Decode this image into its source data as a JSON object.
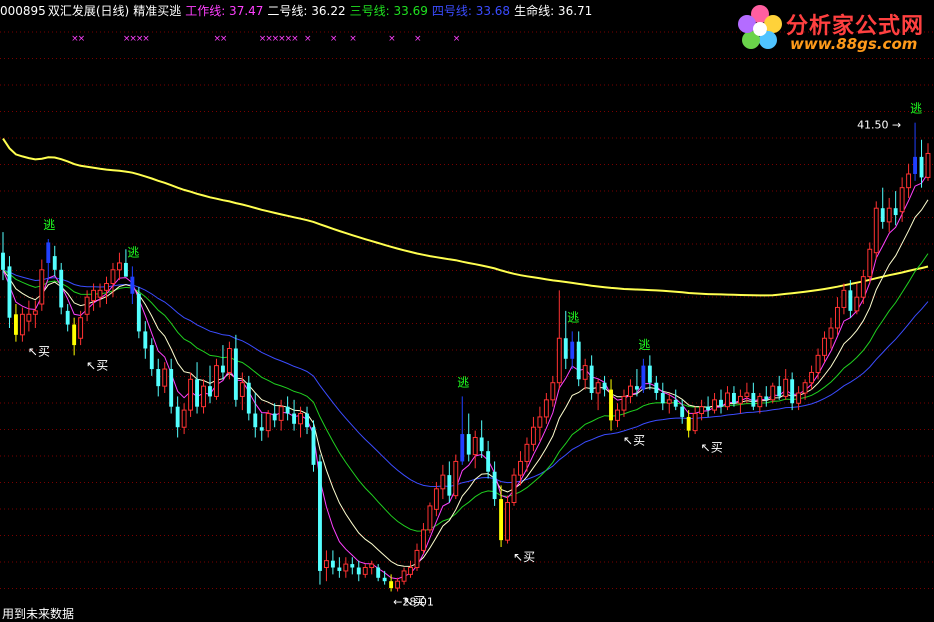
{
  "header": {
    "code": "000895",
    "name": "双汇发展(日线)",
    "indicator": "精准买逃",
    "work_label": "工作线: 37.47",
    "line2_label": "二号线: 36.22",
    "line3_label": "三号线: 33.69",
    "line4_label": "四号线: 33.68",
    "life_label": "生命线: 36.71"
  },
  "logo": {
    "title": "分析家公式网",
    "url": "www.88gs.com"
  },
  "footer": {
    "text": "用到未来数据"
  },
  "colors": {
    "up": "#ff3232",
    "down": "#54ffff",
    "work": "#ff40ff",
    "line2": "#ffffd0",
    "line3": "#20d020",
    "line4": "#3b4cff",
    "life": "#ffff50",
    "buy_bar": "#ffff00",
    "escape_bar": "#2040ff",
    "signal_text": "#20ff20",
    "grid": "#7a0000"
  },
  "chart_data": {
    "type": "candlestick",
    "y_range": [
      27.2,
      44.5
    ],
    "grid": "dotted horizontal",
    "max_label": "41.50",
    "min_label": "28.01",
    "signal_escape": "逃",
    "signal_buy": "买",
    "cross_mark": "×",
    "candles": [
      {
        "o": 37.7,
        "h": 38.3,
        "l": 36.9,
        "c": 37.2,
        "s": 0
      },
      {
        "o": 37.3,
        "h": 37.6,
        "l": 35.5,
        "c": 35.8,
        "s": 0
      },
      {
        "o": 35.9,
        "h": 36.2,
        "l": 35.1,
        "c": 35.3,
        "s": 1
      },
      {
        "o": 35.3,
        "h": 36.1,
        "l": 35.1,
        "c": 35.9,
        "s": 0
      },
      {
        "o": 35.7,
        "h": 36.3,
        "l": 35.4,
        "c": 35.9,
        "s": 0
      },
      {
        "o": 35.9,
        "h": 36.3,
        "l": 35.5,
        "c": 36.0,
        "s": 0
      },
      {
        "o": 36.2,
        "h": 37.5,
        "l": 36.0,
        "c": 37.2,
        "s": 0
      },
      {
        "o": 37.4,
        "h": 38.1,
        "l": 36.9,
        "c": 38.0,
        "s": 2
      },
      {
        "o": 37.6,
        "h": 37.9,
        "l": 37.0,
        "c": 37.2,
        "s": 0
      },
      {
        "o": 37.2,
        "h": 37.4,
        "l": 35.9,
        "c": 36.1,
        "s": 0
      },
      {
        "o": 36.0,
        "h": 36.2,
        "l": 35.4,
        "c": 35.6,
        "s": 0
      },
      {
        "o": 35.6,
        "h": 35.8,
        "l": 34.7,
        "c": 35.0,
        "s": 1
      },
      {
        "o": 35.2,
        "h": 36.0,
        "l": 35.0,
        "c": 35.8,
        "s": 0
      },
      {
        "o": 35.9,
        "h": 36.6,
        "l": 35.7,
        "c": 36.4,
        "s": 0
      },
      {
        "o": 36.3,
        "h": 36.8,
        "l": 36.0,
        "c": 36.6,
        "s": 0
      },
      {
        "o": 36.4,
        "h": 36.8,
        "l": 36.1,
        "c": 36.6,
        "s": 0
      },
      {
        "o": 36.6,
        "h": 37.0,
        "l": 36.2,
        "c": 36.8,
        "s": 0
      },
      {
        "o": 36.8,
        "h": 37.4,
        "l": 36.4,
        "c": 37.2,
        "s": 0
      },
      {
        "o": 37.2,
        "h": 37.7,
        "l": 36.9,
        "c": 37.4,
        "s": 0
      },
      {
        "o": 37.4,
        "h": 37.8,
        "l": 37.0,
        "c": 37.0,
        "s": 0
      },
      {
        "o": 37.0,
        "h": 37.3,
        "l": 36.2,
        "c": 36.5,
        "s": 2
      },
      {
        "o": 36.5,
        "h": 36.7,
        "l": 35.2,
        "c": 35.4,
        "s": 0
      },
      {
        "o": 35.4,
        "h": 35.7,
        "l": 34.6,
        "c": 34.9,
        "s": 0
      },
      {
        "o": 35.0,
        "h": 35.2,
        "l": 34.1,
        "c": 34.3,
        "s": 0
      },
      {
        "o": 34.3,
        "h": 34.6,
        "l": 33.5,
        "c": 33.8,
        "s": 0
      },
      {
        "o": 33.8,
        "h": 34.5,
        "l": 33.6,
        "c": 34.3,
        "s": 0
      },
      {
        "o": 34.3,
        "h": 34.6,
        "l": 33.0,
        "c": 33.2,
        "s": 0
      },
      {
        "o": 33.2,
        "h": 33.5,
        "l": 32.3,
        "c": 32.6,
        "s": 0
      },
      {
        "o": 32.6,
        "h": 33.3,
        "l": 32.4,
        "c": 33.1,
        "s": 0
      },
      {
        "o": 33.1,
        "h": 34.2,
        "l": 32.9,
        "c": 34.0,
        "s": 0
      },
      {
        "o": 34.0,
        "h": 34.5,
        "l": 33.0,
        "c": 33.2,
        "s": 0
      },
      {
        "o": 33.2,
        "h": 34.0,
        "l": 33.0,
        "c": 33.8,
        "s": 0
      },
      {
        "o": 33.8,
        "h": 34.4,
        "l": 33.3,
        "c": 33.5,
        "s": 0
      },
      {
        "o": 33.5,
        "h": 34.6,
        "l": 33.4,
        "c": 34.4,
        "s": 0
      },
      {
        "o": 34.4,
        "h": 35.0,
        "l": 34.0,
        "c": 34.2,
        "s": 0
      },
      {
        "o": 34.2,
        "h": 35.1,
        "l": 34.0,
        "c": 34.9,
        "s": 0
      },
      {
        "o": 34.9,
        "h": 35.3,
        "l": 33.2,
        "c": 33.4,
        "s": 0
      },
      {
        "o": 33.5,
        "h": 34.2,
        "l": 33.1,
        "c": 33.9,
        "s": 0
      },
      {
        "o": 33.9,
        "h": 34.1,
        "l": 32.8,
        "c": 33.0,
        "s": 0
      },
      {
        "o": 33.0,
        "h": 33.6,
        "l": 32.3,
        "c": 32.6,
        "s": 0
      },
      {
        "o": 32.6,
        "h": 33.0,
        "l": 32.2,
        "c": 32.5,
        "s": 0
      },
      {
        "o": 32.5,
        "h": 33.1,
        "l": 32.3,
        "c": 33.0,
        "s": 0
      },
      {
        "o": 33.0,
        "h": 33.3,
        "l": 32.6,
        "c": 32.8,
        "s": 0
      },
      {
        "o": 32.8,
        "h": 33.4,
        "l": 32.5,
        "c": 33.2,
        "s": 0
      },
      {
        "o": 33.2,
        "h": 33.5,
        "l": 32.8,
        "c": 33.0,
        "s": 0
      },
      {
        "o": 33.0,
        "h": 33.4,
        "l": 32.5,
        "c": 32.7,
        "s": 0
      },
      {
        "o": 32.7,
        "h": 33.2,
        "l": 32.3,
        "c": 33.0,
        "s": 0
      },
      {
        "o": 33.0,
        "h": 33.2,
        "l": 32.4,
        "c": 32.6,
        "s": 0
      },
      {
        "o": 32.6,
        "h": 32.8,
        "l": 31.3,
        "c": 31.5,
        "s": 0
      },
      {
        "o": 31.6,
        "h": 31.8,
        "l": 28.0,
        "c": 28.4,
        "s": 0
      },
      {
        "o": 28.5,
        "h": 29.0,
        "l": 28.1,
        "c": 28.7,
        "s": 0
      },
      {
        "o": 28.7,
        "h": 29.0,
        "l": 28.3,
        "c": 28.5,
        "s": 0
      },
      {
        "o": 28.5,
        "h": 28.8,
        "l": 28.2,
        "c": 28.4,
        "s": 0
      },
      {
        "o": 28.4,
        "h": 28.8,
        "l": 28.2,
        "c": 28.6,
        "s": 0
      },
      {
        "o": 28.6,
        "h": 28.8,
        "l": 28.3,
        "c": 28.5,
        "s": 0
      },
      {
        "o": 28.5,
        "h": 28.7,
        "l": 28.1,
        "c": 28.3,
        "s": 0
      },
      {
        "o": 28.3,
        "h": 28.6,
        "l": 28.2,
        "c": 28.5,
        "s": 0
      },
      {
        "o": 28.5,
        "h": 28.7,
        "l": 28.3,
        "c": 28.6,
        "s": 0
      },
      {
        "o": 28.5,
        "h": 28.6,
        "l": 28.1,
        "c": 28.2,
        "s": 0
      },
      {
        "o": 28.2,
        "h": 28.4,
        "l": 28.0,
        "c": 28.1,
        "s": 0
      },
      {
        "o": 28.1,
        "h": 28.3,
        "l": 27.8,
        "c": 27.9,
        "s": 1
      },
      {
        "o": 27.9,
        "h": 28.2,
        "l": 27.8,
        "c": 28.1,
        "s": 0
      },
      {
        "o": 28.1,
        "h": 28.5,
        "l": 28.0,
        "c": 28.4,
        "s": 0
      },
      {
        "o": 28.3,
        "h": 28.7,
        "l": 28.2,
        "c": 28.5,
        "s": 0
      },
      {
        "o": 28.5,
        "h": 29.2,
        "l": 28.4,
        "c": 29.0,
        "s": 0
      },
      {
        "o": 29.0,
        "h": 29.8,
        "l": 28.9,
        "c": 29.6,
        "s": 0
      },
      {
        "o": 29.6,
        "h": 30.4,
        "l": 29.5,
        "c": 30.3,
        "s": 0
      },
      {
        "o": 30.2,
        "h": 31.0,
        "l": 30.0,
        "c": 30.8,
        "s": 0
      },
      {
        "o": 30.8,
        "h": 31.5,
        "l": 30.5,
        "c": 31.2,
        "s": 0
      },
      {
        "o": 31.2,
        "h": 31.6,
        "l": 30.4,
        "c": 30.6,
        "s": 0
      },
      {
        "o": 30.6,
        "h": 31.8,
        "l": 30.5,
        "c": 31.6,
        "s": 0
      },
      {
        "o": 31.6,
        "h": 33.5,
        "l": 31.5,
        "c": 32.4,
        "s": 2
      },
      {
        "o": 32.4,
        "h": 33.0,
        "l": 31.6,
        "c": 31.8,
        "s": 0
      },
      {
        "o": 31.8,
        "h": 32.5,
        "l": 31.4,
        "c": 32.3,
        "s": 0
      },
      {
        "o": 32.3,
        "h": 32.8,
        "l": 31.7,
        "c": 31.9,
        "s": 0
      },
      {
        "o": 31.9,
        "h": 32.2,
        "l": 31.1,
        "c": 31.3,
        "s": 0
      },
      {
        "o": 31.3,
        "h": 31.6,
        "l": 30.3,
        "c": 30.5,
        "s": 0
      },
      {
        "o": 30.5,
        "h": 30.9,
        "l": 29.1,
        "c": 29.3,
        "s": 1
      },
      {
        "o": 29.3,
        "h": 30.6,
        "l": 29.2,
        "c": 30.4,
        "s": 0
      },
      {
        "o": 30.4,
        "h": 31.4,
        "l": 30.3,
        "c": 31.2,
        "s": 0
      },
      {
        "o": 31.2,
        "h": 31.9,
        "l": 30.9,
        "c": 31.6,
        "s": 0
      },
      {
        "o": 31.6,
        "h": 32.3,
        "l": 31.3,
        "c": 32.1,
        "s": 0
      },
      {
        "o": 32.1,
        "h": 32.9,
        "l": 31.9,
        "c": 32.6,
        "s": 0
      },
      {
        "o": 32.6,
        "h": 33.2,
        "l": 32.2,
        "c": 32.9,
        "s": 0
      },
      {
        "o": 32.9,
        "h": 33.6,
        "l": 32.7,
        "c": 33.4,
        "s": 0
      },
      {
        "o": 33.4,
        "h": 34.1,
        "l": 33.2,
        "c": 33.9,
        "s": 0
      },
      {
        "o": 33.9,
        "h": 36.6,
        "l": 33.7,
        "c": 35.2,
        "s": 0
      },
      {
        "o": 35.2,
        "h": 36.0,
        "l": 34.3,
        "c": 34.6,
        "s": 0
      },
      {
        "o": 34.6,
        "h": 35.4,
        "l": 34.3,
        "c": 35.1,
        "s": 2
      },
      {
        "o": 35.1,
        "h": 35.4,
        "l": 33.8,
        "c": 34.0,
        "s": 0
      },
      {
        "o": 34.0,
        "h": 34.6,
        "l": 33.7,
        "c": 34.4,
        "s": 0
      },
      {
        "o": 34.4,
        "h": 34.7,
        "l": 33.4,
        "c": 33.6,
        "s": 0
      },
      {
        "o": 33.6,
        "h": 34.0,
        "l": 33.1,
        "c": 33.9,
        "s": 0
      },
      {
        "o": 33.9,
        "h": 34.1,
        "l": 33.5,
        "c": 33.7,
        "s": 0
      },
      {
        "o": 33.7,
        "h": 34.0,
        "l": 32.5,
        "c": 32.8,
        "s": 1
      },
      {
        "o": 32.8,
        "h": 33.3,
        "l": 32.6,
        "c": 33.1,
        "s": 0
      },
      {
        "o": 33.1,
        "h": 33.7,
        "l": 32.9,
        "c": 33.5,
        "s": 0
      },
      {
        "o": 33.5,
        "h": 34.0,
        "l": 33.3,
        "c": 33.8,
        "s": 0
      },
      {
        "o": 33.8,
        "h": 34.3,
        "l": 33.5,
        "c": 33.7,
        "s": 0
      },
      {
        "o": 33.7,
        "h": 34.6,
        "l": 33.6,
        "c": 34.4,
        "s": 2
      },
      {
        "o": 34.4,
        "h": 34.7,
        "l": 33.7,
        "c": 33.9,
        "s": 0
      },
      {
        "o": 33.9,
        "h": 34.1,
        "l": 33.4,
        "c": 33.6,
        "s": 0
      },
      {
        "o": 33.6,
        "h": 33.9,
        "l": 33.1,
        "c": 33.3,
        "s": 0
      },
      {
        "o": 33.3,
        "h": 33.6,
        "l": 33.0,
        "c": 33.4,
        "s": 0
      },
      {
        "o": 33.4,
        "h": 33.7,
        "l": 33.1,
        "c": 33.2,
        "s": 0
      },
      {
        "o": 33.2,
        "h": 33.4,
        "l": 32.7,
        "c": 32.9,
        "s": 0
      },
      {
        "o": 32.9,
        "h": 33.1,
        "l": 32.3,
        "c": 32.5,
        "s": 1
      },
      {
        "o": 32.5,
        "h": 33.2,
        "l": 32.4,
        "c": 33.0,
        "s": 0
      },
      {
        "o": 33.0,
        "h": 33.4,
        "l": 32.8,
        "c": 33.2,
        "s": 0
      },
      {
        "o": 33.2,
        "h": 33.5,
        "l": 32.9,
        "c": 33.1,
        "s": 0
      },
      {
        "o": 33.1,
        "h": 33.6,
        "l": 33.0,
        "c": 33.4,
        "s": 0
      },
      {
        "o": 33.4,
        "h": 33.7,
        "l": 33.0,
        "c": 33.2,
        "s": 0
      },
      {
        "o": 33.2,
        "h": 33.8,
        "l": 33.1,
        "c": 33.6,
        "s": 0
      },
      {
        "o": 33.6,
        "h": 33.8,
        "l": 33.2,
        "c": 33.3,
        "s": 0
      },
      {
        "o": 33.3,
        "h": 33.7,
        "l": 33.0,
        "c": 33.5,
        "s": 0
      },
      {
        "o": 33.5,
        "h": 33.9,
        "l": 33.3,
        "c": 33.6,
        "s": 0
      },
      {
        "o": 33.6,
        "h": 33.9,
        "l": 33.1,
        "c": 33.2,
        "s": 0
      },
      {
        "o": 33.2,
        "h": 33.6,
        "l": 33.0,
        "c": 33.5,
        "s": 0
      },
      {
        "o": 33.5,
        "h": 33.8,
        "l": 33.2,
        "c": 33.4,
        "s": 0
      },
      {
        "o": 33.4,
        "h": 33.9,
        "l": 33.3,
        "c": 33.8,
        "s": 0
      },
      {
        "o": 33.8,
        "h": 34.1,
        "l": 33.4,
        "c": 33.5,
        "s": 0
      },
      {
        "o": 33.5,
        "h": 34.3,
        "l": 33.4,
        "c": 34.0,
        "s": 0
      },
      {
        "o": 34.0,
        "h": 34.2,
        "l": 33.1,
        "c": 33.3,
        "s": 0
      },
      {
        "o": 33.3,
        "h": 33.8,
        "l": 33.1,
        "c": 33.6,
        "s": 0
      },
      {
        "o": 33.6,
        "h": 34.0,
        "l": 33.4,
        "c": 33.9,
        "s": 0
      },
      {
        "o": 33.9,
        "h": 34.4,
        "l": 33.7,
        "c": 34.2,
        "s": 0
      },
      {
        "o": 34.2,
        "h": 34.9,
        "l": 34.0,
        "c": 34.7,
        "s": 0
      },
      {
        "o": 34.7,
        "h": 35.4,
        "l": 34.5,
        "c": 35.2,
        "s": 0
      },
      {
        "o": 35.2,
        "h": 35.8,
        "l": 34.9,
        "c": 35.5,
        "s": 0
      },
      {
        "o": 35.5,
        "h": 36.4,
        "l": 35.3,
        "c": 36.1,
        "s": 0
      },
      {
        "o": 36.1,
        "h": 36.8,
        "l": 35.9,
        "c": 36.6,
        "s": 0
      },
      {
        "o": 36.6,
        "h": 36.9,
        "l": 35.8,
        "c": 36.0,
        "s": 0
      },
      {
        "o": 36.0,
        "h": 36.8,
        "l": 35.9,
        "c": 36.4,
        "s": 0
      },
      {
        "o": 36.4,
        "h": 37.2,
        "l": 36.2,
        "c": 37.0,
        "s": 0
      },
      {
        "o": 37.0,
        "h": 38.0,
        "l": 36.8,
        "c": 37.8,
        "s": 0
      },
      {
        "o": 37.7,
        "h": 39.2,
        "l": 37.5,
        "c": 39.0,
        "s": 0
      },
      {
        "o": 39.0,
        "h": 39.6,
        "l": 38.4,
        "c": 38.6,
        "s": 0
      },
      {
        "o": 38.6,
        "h": 39.3,
        "l": 38.3,
        "c": 39.0,
        "s": 0
      },
      {
        "o": 39.0,
        "h": 39.5,
        "l": 38.5,
        "c": 38.8,
        "s": 0
      },
      {
        "o": 38.9,
        "h": 39.9,
        "l": 38.6,
        "c": 39.6,
        "s": 0
      },
      {
        "o": 39.6,
        "h": 40.3,
        "l": 39.3,
        "c": 40.0,
        "s": 0
      },
      {
        "o": 40.0,
        "h": 41.5,
        "l": 39.8,
        "c": 40.5,
        "s": 2
      },
      {
        "o": 40.5,
        "h": 41.0,
        "l": 39.6,
        "c": 39.9,
        "s": 0
      },
      {
        "o": 39.9,
        "h": 40.9,
        "l": 39.8,
        "c": 40.6,
        "s": 0
      }
    ],
    "crosses_at": [
      11,
      12,
      19,
      20,
      21,
      22,
      33,
      34,
      40,
      41,
      42,
      43,
      44,
      45,
      47,
      51,
      54,
      60,
      64,
      70
    ]
  }
}
